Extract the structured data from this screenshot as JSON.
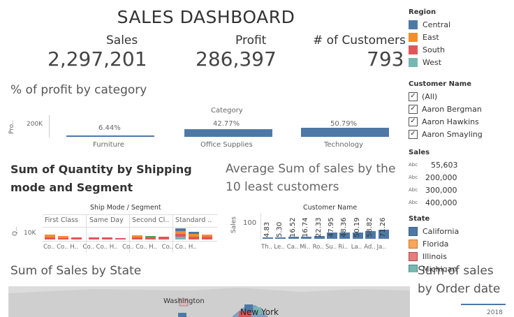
{
  "title": "SALES DASHBOARD",
  "kpis": [
    {
      "label": "Sales",
      "value": "2,297,201"
    },
    {
      "label": "Profit",
      "value": "286,397"
    },
    {
      "label": "# of Customers",
      "value": "793"
    }
  ],
  "profit_by_category": {
    "title": "% of profit by category",
    "header": "Category",
    "ylabel": "Pro..",
    "ytick": "200K",
    "categories": [
      "Furniture",
      "Office Supplies",
      "Technology"
    ],
    "labels": [
      "6.44%",
      "42.77%",
      "50.79%"
    ]
  },
  "quantity_chart": {
    "title_line1": "Sum of Quantity by Shipping",
    "title_line2": "mode and Segment",
    "header": "Ship Mode / Segment",
    "ylabel": "Q..",
    "ytick": "10K",
    "modes": [
      "First Class",
      "Same Day",
      "Second Cl..",
      "Standard .."
    ],
    "segments": [
      "Co..",
      "Co..",
      "H.."
    ]
  },
  "avg_chart": {
    "title_line1": "Average Sum of sales by the",
    "title_line2": "10 least customers",
    "header": "Customer Name",
    "ylabel": "Sales",
    "ytick": "100",
    "value_labels": [
      "4.83",
      "5.30",
      "16.52",
      "16.74",
      "22.33",
      "47.95",
      "48.36",
      "50.19",
      "58.82",
      "71.26"
    ],
    "customer_labels": [
      "Th..",
      "Le..",
      "Ca..",
      "Mi..",
      "Ro..",
      "Su..",
      "Ri..",
      "La..",
      "Ad..",
      "Ja.."
    ]
  },
  "state_map": {
    "title": "Sum of Sales by State",
    "labels": [
      "Washington",
      "New York"
    ]
  },
  "order_date": {
    "title_line1": "Sum of sales",
    "title_line2": "by Order date",
    "year": "2018"
  },
  "filters": {
    "region": {
      "head": "Region",
      "items": [
        {
          "label": "Central",
          "color": "#4e79a7"
        },
        {
          "label": "East",
          "color": "#f28e2b"
        },
        {
          "label": "South",
          "color": "#e15759"
        },
        {
          "label": "West",
          "color": "#76b7b2"
        }
      ]
    },
    "customer": {
      "head": "Customer Name",
      "items": [
        "(All)",
        "Aaron Bergman",
        "Aaron Hawkins",
        "Aaron Smayling"
      ]
    },
    "sales": {
      "head": "Sales",
      "abc": "Abc",
      "items": [
        "55,603",
        "200,000",
        "300,000",
        "400,000"
      ]
    },
    "state": {
      "head": "State",
      "items": [
        {
          "label": "California",
          "color": "#4e79a7"
        },
        {
          "label": "Florida",
          "color": "#f28e2b"
        },
        {
          "label": "Illinois",
          "color": "#e15759"
        },
        {
          "label": "Michigan",
          "color": "#76b7b2"
        }
      ]
    }
  },
  "colors": {
    "bar": "#4e79a7",
    "orange": "#f28e2b",
    "red": "#e15759",
    "teal": "#76b7b2",
    "green": "#59a14f"
  }
}
